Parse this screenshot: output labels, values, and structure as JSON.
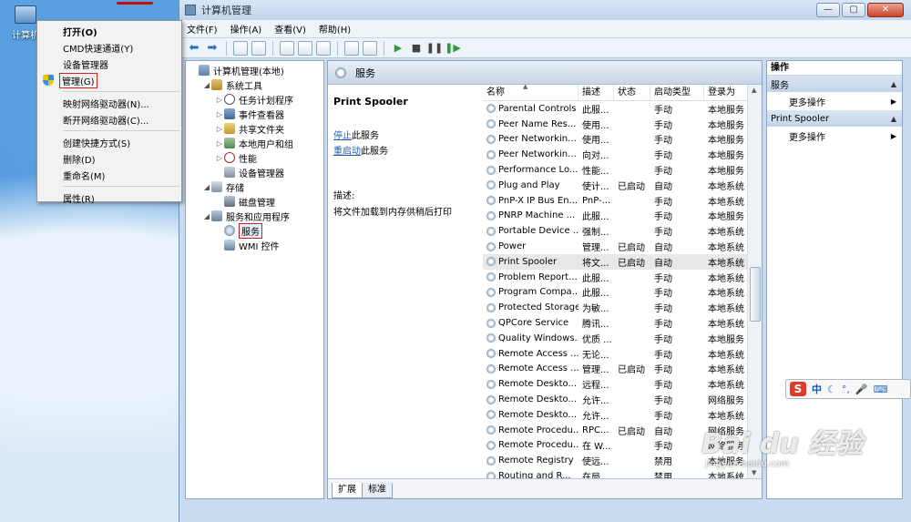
{
  "desktop": {
    "icon_label": "计算机"
  },
  "context_menu": [
    {
      "label": "打开(O)",
      "bold": true
    },
    {
      "label": "CMD快速通道(Y)"
    },
    {
      "label": "设备管理器"
    },
    {
      "label": "管理(G)",
      "highlight": true
    },
    {
      "sep": true
    },
    {
      "label": "映射网络驱动器(N)..."
    },
    {
      "label": "断开网络驱动器(C)..."
    },
    {
      "sep": true
    },
    {
      "label": "创建快捷方式(S)"
    },
    {
      "label": "删除(D)"
    },
    {
      "label": "重命名(M)"
    },
    {
      "sep": true
    },
    {
      "label": "属性(R)"
    }
  ],
  "window": {
    "title": "计算机管理",
    "buttons": {
      "minimize": "—",
      "maximize": "▢",
      "close": "✕"
    },
    "menu": [
      "文件(F)",
      "操作(A)",
      "查看(V)",
      "帮助(H)"
    ]
  },
  "tree": [
    {
      "label": "计算机管理(本地)",
      "indent": 0,
      "icon": "computer-icon",
      "cls": "ic-comp",
      "arrow": ""
    },
    {
      "label": "系统工具",
      "indent": 1,
      "icon": "tools-icon",
      "cls": "ic-tools",
      "arrow": "◢"
    },
    {
      "label": "任务计划程序",
      "indent": 2,
      "icon": "clock-icon",
      "cls": "ic-clock",
      "arrow": "▷"
    },
    {
      "label": "事件查看器",
      "indent": 2,
      "icon": "event-viewer-icon",
      "cls": "ic-event",
      "arrow": "▷"
    },
    {
      "label": "共享文件夹",
      "indent": 2,
      "icon": "shared-folder-icon",
      "cls": "ic-share",
      "arrow": "▷"
    },
    {
      "label": "本地用户和组",
      "indent": 2,
      "icon": "users-icon",
      "cls": "ic-users",
      "arrow": "▷"
    },
    {
      "label": "性能",
      "indent": 2,
      "icon": "performance-icon",
      "cls": "ic-perf",
      "arrow": "▷"
    },
    {
      "label": "设备管理器",
      "indent": 2,
      "icon": "device-manager-icon",
      "cls": "ic-dev",
      "arrow": ""
    },
    {
      "label": "存储",
      "indent": 1,
      "icon": "storage-icon",
      "cls": "ic-store",
      "arrow": "◢"
    },
    {
      "label": "磁盘管理",
      "indent": 2,
      "icon": "disk-icon",
      "cls": "ic-disk",
      "arrow": ""
    },
    {
      "label": "服务和应用程序",
      "indent": 1,
      "icon": "apps-icon",
      "cls": "ic-apps",
      "arrow": "◢"
    },
    {
      "label": "服务",
      "indent": 2,
      "icon": "gear-icon",
      "cls": "ic-gear",
      "arrow": "",
      "selected": true
    },
    {
      "label": "WMI 控件",
      "indent": 2,
      "icon": "wmi-icon",
      "cls": "ic-wmi",
      "arrow": ""
    }
  ],
  "services_panel": {
    "title": "服务",
    "selected_name": "Print Spooler",
    "stop_link": "停止",
    "stop_text": "此服务",
    "restart_link": "重启动",
    "restart_text": "此服务",
    "desc_label": "描述:",
    "desc_text": "将文件加载到内存供稍后打印"
  },
  "columns": [
    "名称",
    "描述",
    "状态",
    "启动类型",
    "登录为"
  ],
  "services": [
    [
      "Parental Controls",
      "此服...",
      "",
      "手动",
      "本地服务"
    ],
    [
      "Peer Name Res...",
      "使用...",
      "",
      "手动",
      "本地服务"
    ],
    [
      "Peer Networkin...",
      "使用...",
      "",
      "手动",
      "本地服务"
    ],
    [
      "Peer Networkin...",
      "向对...",
      "",
      "手动",
      "本地服务"
    ],
    [
      "Performance Lo...",
      "性能...",
      "",
      "手动",
      "本地服务"
    ],
    [
      "Plug and Play",
      "使计...",
      "已启动",
      "自动",
      "本地系统"
    ],
    [
      "PnP-X IP Bus En...",
      "PnP-...",
      "",
      "手动",
      "本地系统"
    ],
    [
      "PNRP Machine ...",
      "此服...",
      "",
      "手动",
      "本地服务"
    ],
    [
      "Portable Device ...",
      "强制...",
      "",
      "手动",
      "本地系统"
    ],
    [
      "Power",
      "管理...",
      "已启动",
      "自动",
      "本地系统"
    ],
    [
      "Print Spooler",
      "将文...",
      "已启动",
      "自动",
      "本地系统"
    ],
    [
      "Problem Report...",
      "此服...",
      "",
      "手动",
      "本地系统"
    ],
    [
      "Program Compa...",
      "此服...",
      "",
      "手动",
      "本地系统"
    ],
    [
      "Protected Storage",
      "为敏...",
      "",
      "手动",
      "本地系统"
    ],
    [
      "QPCore Service",
      "腾讯...",
      "",
      "手动",
      "本地系统"
    ],
    [
      "Quality Windows...",
      "优质 ...",
      "",
      "手动",
      "本地服务"
    ],
    [
      "Remote Access ...",
      "无论...",
      "",
      "手动",
      "本地系统"
    ],
    [
      "Remote Access ...",
      "管理...",
      "已启动",
      "手动",
      "本地系统"
    ],
    [
      "Remote Deskto...",
      "远程...",
      "",
      "手动",
      "本地系统"
    ],
    [
      "Remote Deskto...",
      "允许...",
      "",
      "手动",
      "网络服务"
    ],
    [
      "Remote Deskto...",
      "允许...",
      "",
      "手动",
      "本地系统"
    ],
    [
      "Remote Procedu...",
      "RPC...",
      "已启动",
      "自动",
      "网络服务"
    ],
    [
      "Remote Procedu...",
      "在 W...",
      "",
      "手动",
      "网络服务"
    ],
    [
      "Remote Registry",
      "使远...",
      "",
      "禁用",
      "本地服务"
    ],
    [
      "Routing and R...",
      "在局...",
      "",
      "禁用",
      "本地系统"
    ]
  ],
  "tabs": [
    "扩展",
    "标准"
  ],
  "actions": {
    "title": "操作",
    "sections": [
      {
        "label": "服务",
        "item": "更多操作"
      },
      {
        "label": "Print Spooler",
        "item": "更多操作"
      }
    ]
  },
  "ime": {
    "logo": "S",
    "lang": "中"
  },
  "watermark": {
    "big": "Bai du 经验",
    "small": "jingyan.baidu.com"
  }
}
